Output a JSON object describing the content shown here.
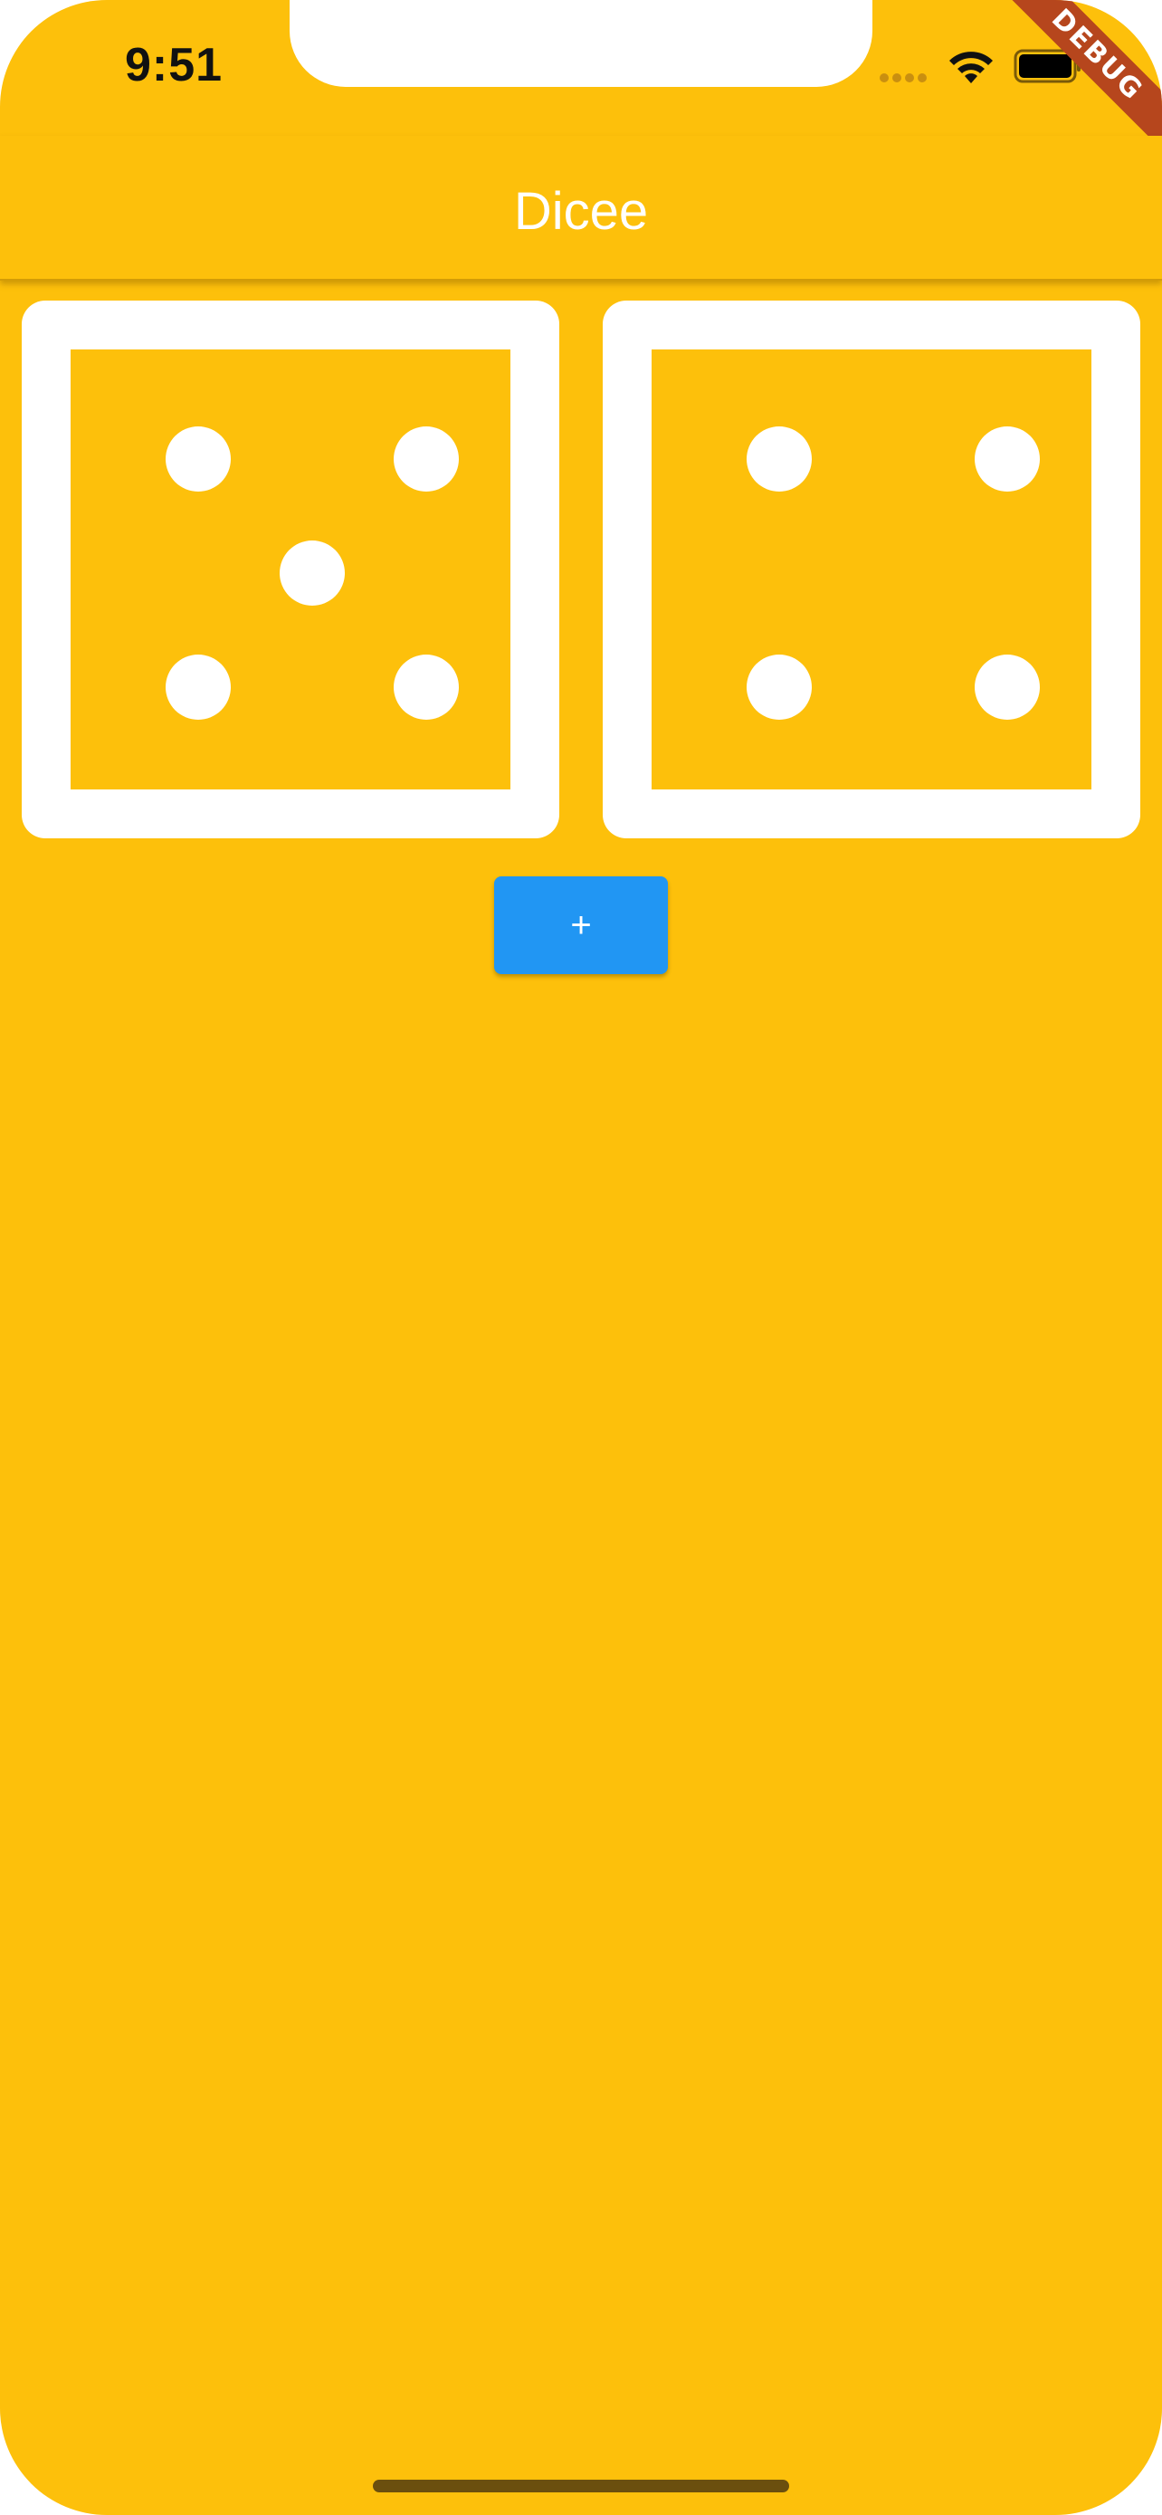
{
  "status_bar": {
    "time": "9:51",
    "signal_icon": "cellular-signal-icon",
    "wifi_icon": "wifi-icon",
    "battery_icon": "battery-icon"
  },
  "debug_banner": {
    "label": "DEBUG",
    "color": "#B6461D"
  },
  "app_bar": {
    "title": "Dicee"
  },
  "dice": [
    {
      "name": "left-die",
      "face_value": 5
    },
    {
      "name": "right-die",
      "face_value": 4
    }
  ],
  "plus_button": {
    "label": "+"
  },
  "colors": {
    "background": "#FDC00B",
    "die": "#FFFFFF",
    "button": "#2196F3"
  }
}
